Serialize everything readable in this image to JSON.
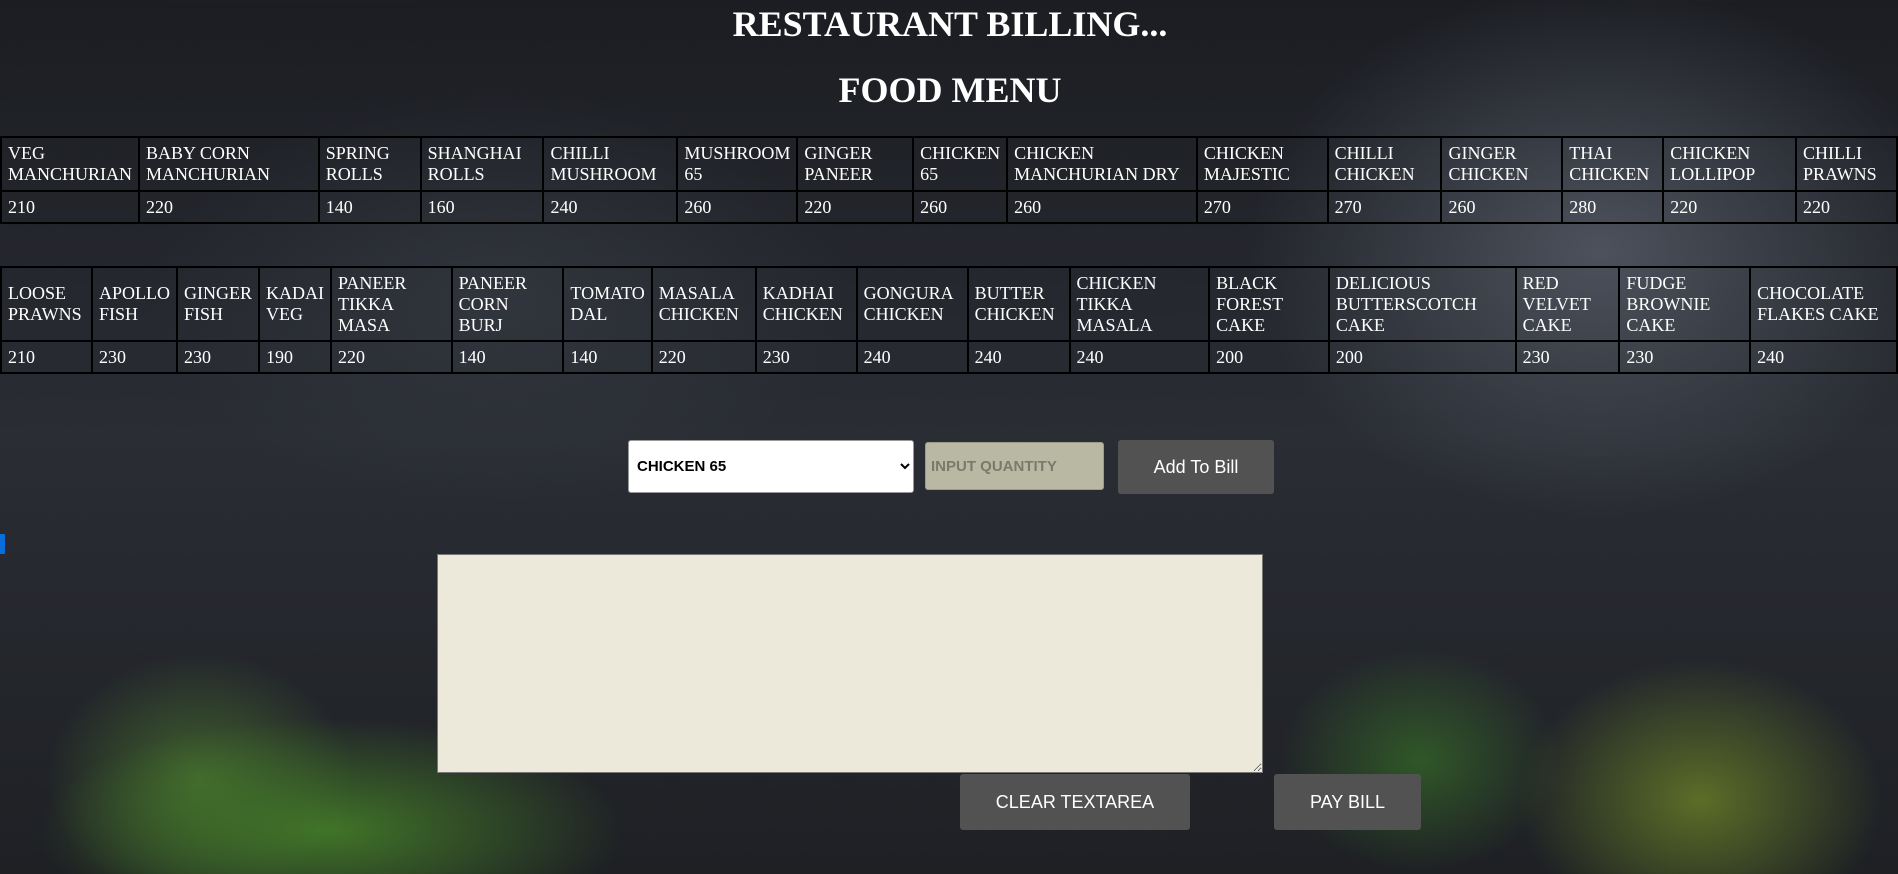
{
  "header": {
    "title": "RESTAURANT BILLING...",
    "menu_title": "FOOD MENU"
  },
  "menu_rows": [
    {
      "names": [
        "VEG MANCHURIAN",
        "BABY CORN MANCHURIAN",
        "SPRING ROLLS",
        "SHANGHAI ROLLS",
        "CHILLI MUSHROOM",
        "MUSHROOM 65",
        "GINGER PANEER",
        "CHICKEN 65",
        "CHICKEN MANCHURIAN DRY",
        "CHICKEN MAJESTIC",
        "CHILLI CHICKEN",
        "GINGER CHICKEN",
        "THAI CHICKEN",
        "CHICKEN LOLLIPOP",
        "CHILLI PRAWNS"
      ],
      "prices": [
        "210",
        "220",
        "140",
        "160",
        "240",
        "260",
        "220",
        "260",
        "260",
        "270",
        "270",
        "260",
        "280",
        "220",
        "220"
      ]
    },
    {
      "names": [
        "LOOSE PRAWNS",
        "APOLLO FISH",
        "GINGER FISH",
        "KADAI VEG",
        "PANEER TIKKA MASA",
        "PANEER CORN BURJ",
        "TOMATO DAL",
        "MASALA CHICKEN",
        "KADHAI CHICKEN",
        "GONGURA CHICKEN",
        "BUTTER CHICKEN",
        "CHICKEN TIKKA MASALA",
        "BLACK FOREST CAKE",
        "DELICIOUS BUTTERSCOTCH CAKE",
        "RED VELVET CAKE",
        "FUDGE BROWNIE CAKE",
        "CHOCOLATE FLAKES CAKE"
      ],
      "prices": [
        "210",
        "230",
        "230",
        "190",
        "220",
        "140",
        "140",
        "220",
        "230",
        "240",
        "240",
        "240",
        "200",
        "200",
        "230",
        "230",
        "240"
      ]
    }
  ],
  "controls": {
    "selected_item": "CHICKEN 65",
    "quantity_placeholder": "INPUT QUANTITY",
    "add_label": "Add To Bill"
  },
  "bill": {
    "text": ""
  },
  "actions": {
    "clear_label": "CLEAR TEXTAREA",
    "pay_label": "PAY BILL"
  },
  "colors": {
    "button_bg": "#525252",
    "textarea_bg": "#ece8da",
    "quantity_bg": "#b9b9a3",
    "focus_marker": "#0a6cd8"
  }
}
